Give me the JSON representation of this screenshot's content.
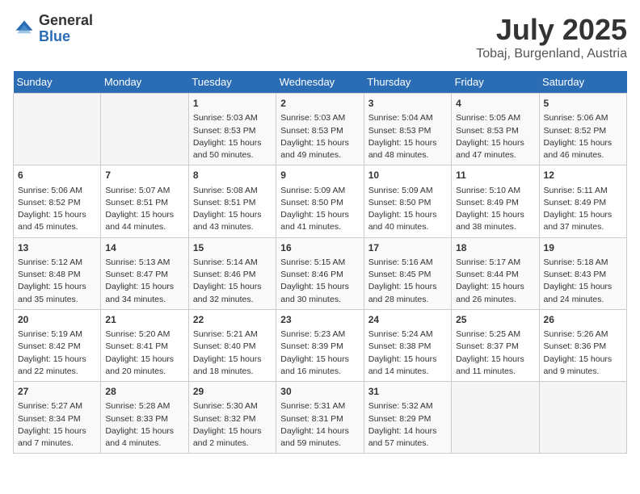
{
  "header": {
    "logo_general": "General",
    "logo_blue": "Blue",
    "title": "July 2025",
    "subtitle": "Tobaj, Burgenland, Austria"
  },
  "days_of_week": [
    "Sunday",
    "Monday",
    "Tuesday",
    "Wednesday",
    "Thursday",
    "Friday",
    "Saturday"
  ],
  "weeks": [
    [
      {
        "day": "",
        "empty": true
      },
      {
        "day": "",
        "empty": true
      },
      {
        "day": "1",
        "sunrise": "Sunrise: 5:03 AM",
        "sunset": "Sunset: 8:53 PM",
        "daylight": "Daylight: 15 hours and 50 minutes."
      },
      {
        "day": "2",
        "sunrise": "Sunrise: 5:03 AM",
        "sunset": "Sunset: 8:53 PM",
        "daylight": "Daylight: 15 hours and 49 minutes."
      },
      {
        "day": "3",
        "sunrise": "Sunrise: 5:04 AM",
        "sunset": "Sunset: 8:53 PM",
        "daylight": "Daylight: 15 hours and 48 minutes."
      },
      {
        "day": "4",
        "sunrise": "Sunrise: 5:05 AM",
        "sunset": "Sunset: 8:53 PM",
        "daylight": "Daylight: 15 hours and 47 minutes."
      },
      {
        "day": "5",
        "sunrise": "Sunrise: 5:06 AM",
        "sunset": "Sunset: 8:52 PM",
        "daylight": "Daylight: 15 hours and 46 minutes."
      }
    ],
    [
      {
        "day": "6",
        "sunrise": "Sunrise: 5:06 AM",
        "sunset": "Sunset: 8:52 PM",
        "daylight": "Daylight: 15 hours and 45 minutes."
      },
      {
        "day": "7",
        "sunrise": "Sunrise: 5:07 AM",
        "sunset": "Sunset: 8:51 PM",
        "daylight": "Daylight: 15 hours and 44 minutes."
      },
      {
        "day": "8",
        "sunrise": "Sunrise: 5:08 AM",
        "sunset": "Sunset: 8:51 PM",
        "daylight": "Daylight: 15 hours and 43 minutes."
      },
      {
        "day": "9",
        "sunrise": "Sunrise: 5:09 AM",
        "sunset": "Sunset: 8:50 PM",
        "daylight": "Daylight: 15 hours and 41 minutes."
      },
      {
        "day": "10",
        "sunrise": "Sunrise: 5:09 AM",
        "sunset": "Sunset: 8:50 PM",
        "daylight": "Daylight: 15 hours and 40 minutes."
      },
      {
        "day": "11",
        "sunrise": "Sunrise: 5:10 AM",
        "sunset": "Sunset: 8:49 PM",
        "daylight": "Daylight: 15 hours and 38 minutes."
      },
      {
        "day": "12",
        "sunrise": "Sunrise: 5:11 AM",
        "sunset": "Sunset: 8:49 PM",
        "daylight": "Daylight: 15 hours and 37 minutes."
      }
    ],
    [
      {
        "day": "13",
        "sunrise": "Sunrise: 5:12 AM",
        "sunset": "Sunset: 8:48 PM",
        "daylight": "Daylight: 15 hours and 35 minutes."
      },
      {
        "day": "14",
        "sunrise": "Sunrise: 5:13 AM",
        "sunset": "Sunset: 8:47 PM",
        "daylight": "Daylight: 15 hours and 34 minutes."
      },
      {
        "day": "15",
        "sunrise": "Sunrise: 5:14 AM",
        "sunset": "Sunset: 8:46 PM",
        "daylight": "Daylight: 15 hours and 32 minutes."
      },
      {
        "day": "16",
        "sunrise": "Sunrise: 5:15 AM",
        "sunset": "Sunset: 8:46 PM",
        "daylight": "Daylight: 15 hours and 30 minutes."
      },
      {
        "day": "17",
        "sunrise": "Sunrise: 5:16 AM",
        "sunset": "Sunset: 8:45 PM",
        "daylight": "Daylight: 15 hours and 28 minutes."
      },
      {
        "day": "18",
        "sunrise": "Sunrise: 5:17 AM",
        "sunset": "Sunset: 8:44 PM",
        "daylight": "Daylight: 15 hours and 26 minutes."
      },
      {
        "day": "19",
        "sunrise": "Sunrise: 5:18 AM",
        "sunset": "Sunset: 8:43 PM",
        "daylight": "Daylight: 15 hours and 24 minutes."
      }
    ],
    [
      {
        "day": "20",
        "sunrise": "Sunrise: 5:19 AM",
        "sunset": "Sunset: 8:42 PM",
        "daylight": "Daylight: 15 hours and 22 minutes."
      },
      {
        "day": "21",
        "sunrise": "Sunrise: 5:20 AM",
        "sunset": "Sunset: 8:41 PM",
        "daylight": "Daylight: 15 hours and 20 minutes."
      },
      {
        "day": "22",
        "sunrise": "Sunrise: 5:21 AM",
        "sunset": "Sunset: 8:40 PM",
        "daylight": "Daylight: 15 hours and 18 minutes."
      },
      {
        "day": "23",
        "sunrise": "Sunrise: 5:23 AM",
        "sunset": "Sunset: 8:39 PM",
        "daylight": "Daylight: 15 hours and 16 minutes."
      },
      {
        "day": "24",
        "sunrise": "Sunrise: 5:24 AM",
        "sunset": "Sunset: 8:38 PM",
        "daylight": "Daylight: 15 hours and 14 minutes."
      },
      {
        "day": "25",
        "sunrise": "Sunrise: 5:25 AM",
        "sunset": "Sunset: 8:37 PM",
        "daylight": "Daylight: 15 hours and 11 minutes."
      },
      {
        "day": "26",
        "sunrise": "Sunrise: 5:26 AM",
        "sunset": "Sunset: 8:36 PM",
        "daylight": "Daylight: 15 hours and 9 minutes."
      }
    ],
    [
      {
        "day": "27",
        "sunrise": "Sunrise: 5:27 AM",
        "sunset": "Sunset: 8:34 PM",
        "daylight": "Daylight: 15 hours and 7 minutes."
      },
      {
        "day": "28",
        "sunrise": "Sunrise: 5:28 AM",
        "sunset": "Sunset: 8:33 PM",
        "daylight": "Daylight: 15 hours and 4 minutes."
      },
      {
        "day": "29",
        "sunrise": "Sunrise: 5:30 AM",
        "sunset": "Sunset: 8:32 PM",
        "daylight": "Daylight: 15 hours and 2 minutes."
      },
      {
        "day": "30",
        "sunrise": "Sunrise: 5:31 AM",
        "sunset": "Sunset: 8:31 PM",
        "daylight": "Daylight: 14 hours and 59 minutes."
      },
      {
        "day": "31",
        "sunrise": "Sunrise: 5:32 AM",
        "sunset": "Sunset: 8:29 PM",
        "daylight": "Daylight: 14 hours and 57 minutes."
      },
      {
        "day": "",
        "empty": true
      },
      {
        "day": "",
        "empty": true
      }
    ]
  ]
}
